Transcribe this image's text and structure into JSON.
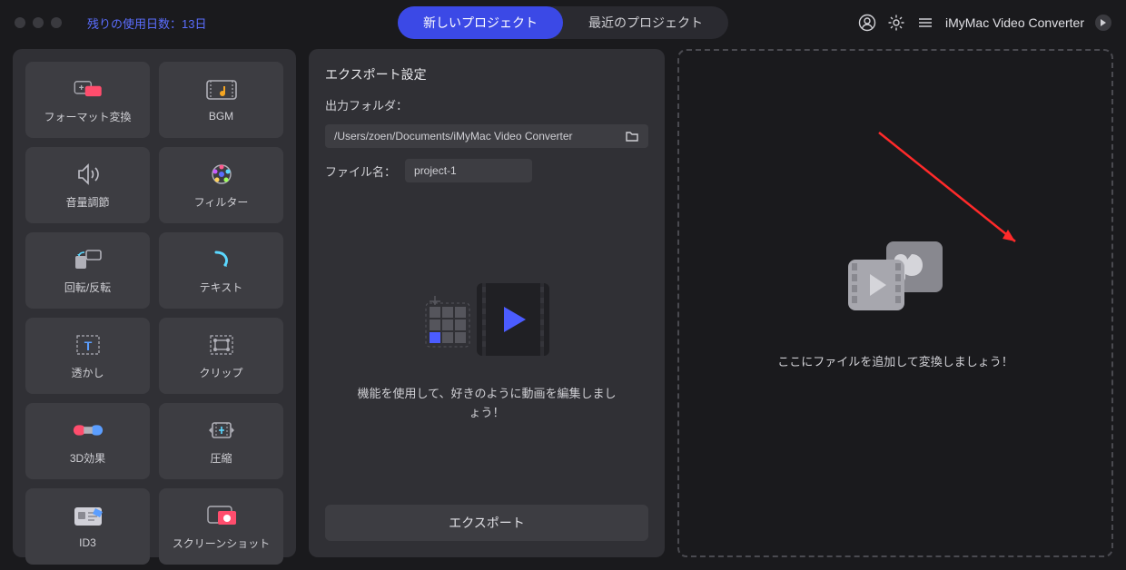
{
  "trial_text": "残りの使用日数：13日",
  "tabs": {
    "new_project": "新しいプロジェクト",
    "recent_project": "最近のプロジェクト"
  },
  "app_name": "iMyMac Video Converter",
  "tools": [
    {
      "id": "format-convert",
      "label": "フォーマット変換"
    },
    {
      "id": "bgm",
      "label": "BGM"
    },
    {
      "id": "volume",
      "label": "音量調節"
    },
    {
      "id": "filter",
      "label": "フィルター"
    },
    {
      "id": "rotate",
      "label": "回転/反転"
    },
    {
      "id": "text",
      "label": "テキスト"
    },
    {
      "id": "watermark",
      "label": "透かし"
    },
    {
      "id": "clip",
      "label": "クリップ"
    },
    {
      "id": "3d-effect",
      "label": "3D効果"
    },
    {
      "id": "compress",
      "label": "圧縮"
    },
    {
      "id": "id3",
      "label": "ID3"
    },
    {
      "id": "screenshot",
      "label": "スクリーンショット"
    }
  ],
  "export": {
    "header": "エクスポート設定",
    "folder_label": "出力フォルダ：",
    "folder_path": "/Users/zoen/Documents/iMyMac Video Converter",
    "filename_label": "ファイル名：",
    "filename_value": "project-1",
    "center_msg": "機能を使用して、好きのように動画を編集しましょう！",
    "button": "エクスポート"
  },
  "dropzone_msg": "ここにファイルを追加して変換しましょう！"
}
